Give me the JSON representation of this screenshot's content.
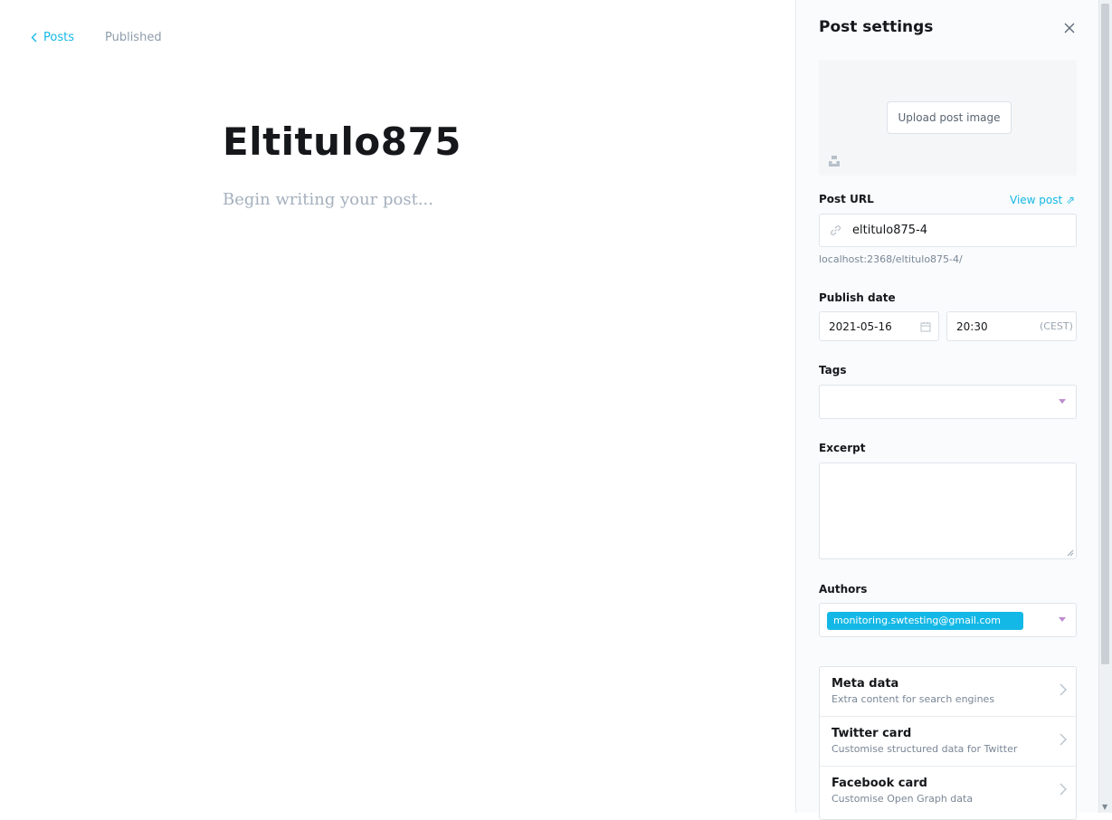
{
  "editor": {
    "back_label": "Posts",
    "status": "Published",
    "title": "Eltitulo875",
    "body_placeholder": "Begin writing your post..."
  },
  "settings": {
    "heading": "Post settings",
    "upload_label": "Upload post image",
    "post_url_label": "Post URL",
    "view_post_label": "View post ⇗",
    "slug": "eltitulo875-4",
    "url_preview": "localhost:2368/eltitulo875-4/",
    "publish_date_label": "Publish date",
    "date": "2021-05-16",
    "time": "20:30",
    "timezone": "(CEST)",
    "tags_label": "Tags",
    "excerpt_label": "Excerpt",
    "authors_label": "Authors",
    "author_token": "monitoring.swtesting@gmail.com",
    "menu": [
      {
        "title": "Meta data",
        "desc": "Extra content for search engines"
      },
      {
        "title": "Twitter card",
        "desc": "Customise structured data for Twitter"
      },
      {
        "title": "Facebook card",
        "desc": "Customise Open Graph data"
      }
    ]
  },
  "colors": {
    "accent": "#14b8e6",
    "panel_bg": "#f9fbfd",
    "muted_text": "#8e9cac"
  },
  "icons": [
    "chevron-left-icon",
    "close-icon",
    "unsplash-icon",
    "link-icon",
    "calendar-icon",
    "caret-down-icon",
    "resize-icon",
    "chevron-right-icon"
  ]
}
